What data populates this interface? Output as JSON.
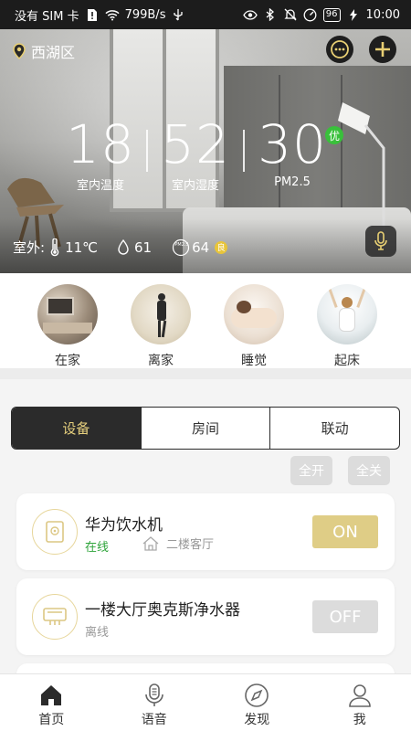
{
  "status_bar": {
    "carrier": "没有 SIM 卡",
    "speed": "799B/s",
    "battery": "96",
    "time": "10:00"
  },
  "hero": {
    "location": "西湖区",
    "metrics": [
      {
        "value": "18",
        "label": "室内温度"
      },
      {
        "value": "52",
        "label": "室内湿度"
      },
      {
        "value": "30",
        "label": "PM2.5"
      }
    ],
    "quality_badge": "优",
    "outdoor": {
      "label": "室外:",
      "temperature": "11℃",
      "humidity": "61",
      "pm_icon_text": "PM2.5",
      "pm": "64",
      "pm_quality": "良"
    }
  },
  "scenes": [
    {
      "label": "在家"
    },
    {
      "label": "离家"
    },
    {
      "label": "睡觉"
    },
    {
      "label": "起床"
    }
  ],
  "tabs": [
    {
      "label": "设备",
      "active": true
    },
    {
      "label": "房间",
      "active": false
    },
    {
      "label": "联动",
      "active": false
    }
  ],
  "actions": {
    "all_on": "全开",
    "all_off": "全关"
  },
  "devices": [
    {
      "name": "华为饮水机",
      "status": "在线",
      "room": "二楼客厅",
      "toggle": "ON"
    },
    {
      "name": "一楼大厅奥克斯净水器",
      "status": "离线",
      "toggle": "OFF"
    }
  ],
  "nav": [
    {
      "label": "首页",
      "icon": "home-icon"
    },
    {
      "label": "语音",
      "icon": "microphone-icon"
    },
    {
      "label": "发现",
      "icon": "compass-icon"
    },
    {
      "label": "我",
      "icon": "user-icon"
    }
  ],
  "colors": {
    "accent_gold": "#dfcd86",
    "online_green": "#2ea43a",
    "dark": "#2b2b2b"
  }
}
